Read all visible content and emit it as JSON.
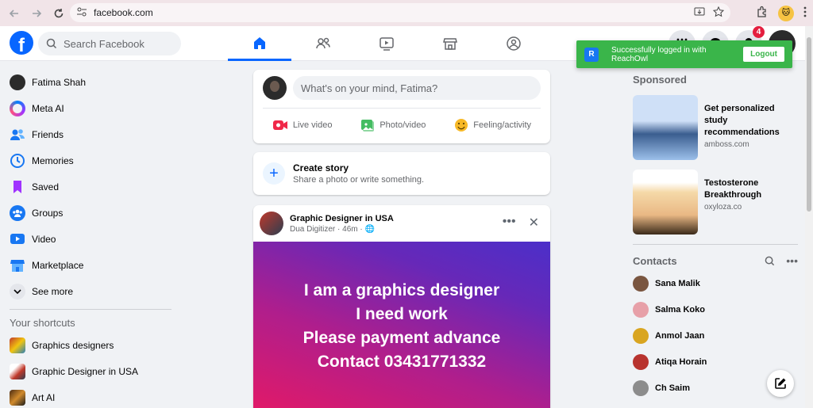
{
  "browser": {
    "url": "facebook.com"
  },
  "topbar": {
    "logo": "f",
    "search_placeholder": "Search Facebook",
    "notification_count": "4"
  },
  "toast": {
    "icon": "R",
    "message": "Successfully logged in with ReachOwl",
    "button": "Logout"
  },
  "sidebar": {
    "items": [
      {
        "label": "Fatima Shah",
        "icon": "avatar"
      },
      {
        "label": "Meta AI",
        "icon": "meta-ai-icon"
      },
      {
        "label": "Friends",
        "icon": "friends-icon"
      },
      {
        "label": "Memories",
        "icon": "memories-icon"
      },
      {
        "label": "Saved",
        "icon": "saved-icon"
      },
      {
        "label": "Groups",
        "icon": "groups-icon"
      },
      {
        "label": "Video",
        "icon": "video-icon"
      },
      {
        "label": "Marketplace",
        "icon": "marketplace-icon"
      },
      {
        "label": "See more",
        "icon": "chevron-down-icon"
      }
    ],
    "shortcuts_heading": "Your shortcuts",
    "shortcuts": [
      {
        "label": "Graphics designers"
      },
      {
        "label": "Graphic Designer in USA"
      },
      {
        "label": "Art AI"
      }
    ]
  },
  "composer": {
    "placeholder": "What's on your mind, Fatima?",
    "actions": [
      {
        "label": "Live video",
        "color": "#f02849"
      },
      {
        "label": "Photo/video",
        "color": "#45bd62"
      },
      {
        "label": "Feeling/activity",
        "color": "#f7b928"
      }
    ]
  },
  "story": {
    "title": "Create story",
    "subtitle": "Share a photo or write something."
  },
  "post": {
    "author": "Graphic Designer in USA",
    "sub_author": "Dua Digitizer",
    "time": "46m",
    "image_lines": [
      "I am a graphics designer",
      "I need work",
      "Please payment advance",
      "Contact 03431771332"
    ]
  },
  "sponsored": {
    "heading": "Sponsored",
    "ads": [
      {
        "title": "Get personalized study recommendations",
        "source": "amboss.com"
      },
      {
        "title": "Testosterone Breakthrough",
        "source": "oxyloza.co"
      }
    ]
  },
  "contacts": {
    "heading": "Contacts",
    "list": [
      {
        "name": "Sana Malik"
      },
      {
        "name": "Salma Koko"
      },
      {
        "name": "Anmol Jaan"
      },
      {
        "name": "Atiqa Horain"
      },
      {
        "name": "Ch Saim"
      }
    ]
  },
  "colors": {
    "fb_blue": "#0866ff",
    "toast_green": "#3ab54a"
  }
}
